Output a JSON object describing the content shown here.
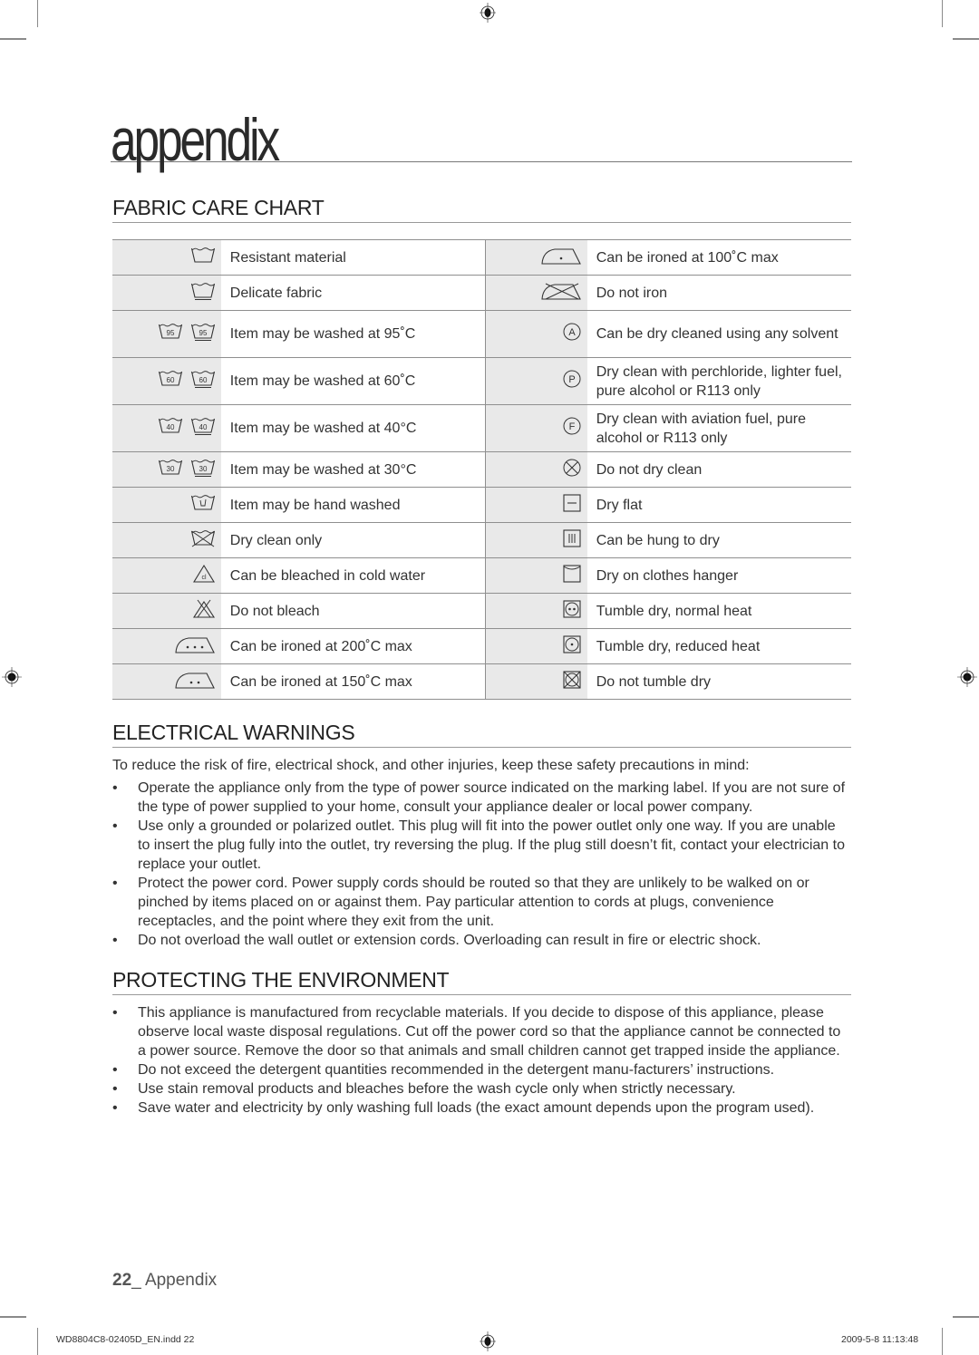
{
  "chapter_title": "appendix",
  "fabric_care": {
    "title": "FABRIC CARE CHART",
    "left": [
      {
        "icons": [
          "washtub-icon"
        ],
        "label": "Resistant material"
      },
      {
        "icons": [
          "washtub-delicate-icon"
        ],
        "label": "Delicate fabric"
      },
      {
        "icons": [
          "wash-95-icon",
          "wash-95-delicate-icon"
        ],
        "temps": [
          "95",
          "95"
        ],
        "label": "Item may be washed at 95˚C"
      },
      {
        "icons": [
          "wash-60-icon",
          "wash-60-delicate-icon"
        ],
        "temps": [
          "60",
          "60"
        ],
        "label": "Item may be washed at 60˚C"
      },
      {
        "icons": [
          "wash-40-icon",
          "wash-40-delicate-icon"
        ],
        "temps": [
          "40",
          "40"
        ],
        "label": "Item may be washed at 40°C"
      },
      {
        "icons": [
          "wash-30-icon",
          "wash-30-delicate-icon"
        ],
        "temps": [
          "30",
          "30"
        ],
        "label": "Item may be washed at 30°C"
      },
      {
        "icons": [
          "hand-wash-icon"
        ],
        "label": "Item may be hand washed"
      },
      {
        "icons": [
          "do-not-wash-icon"
        ],
        "label": "Dry clean only"
      },
      {
        "icons": [
          "bleach-cold-icon"
        ],
        "label": "Can be bleached in cold water"
      },
      {
        "icons": [
          "do-not-bleach-icon"
        ],
        "label": "Do not bleach"
      },
      {
        "icons": [
          "iron-three-dots-icon"
        ],
        "label": "Can be ironed at 200˚C max"
      },
      {
        "icons": [
          "iron-two-dots-icon"
        ],
        "label": "Can be ironed at 150˚C max"
      }
    ],
    "right": [
      {
        "icons": [
          "iron-one-dot-icon"
        ],
        "label": "Can be ironed at 100˚C max"
      },
      {
        "icons": [
          "do-not-iron-icon"
        ],
        "label": "Do not iron"
      },
      {
        "icons": [
          "dry-clean-a-icon"
        ],
        "letter": "A",
        "label": "Can be dry cleaned using any solvent"
      },
      {
        "icons": [
          "dry-clean-p-icon"
        ],
        "letter": "P",
        "label": "Dry clean with perchloride, lighter fuel, pure alcohol or R113 only"
      },
      {
        "icons": [
          "dry-clean-f-icon"
        ],
        "letter": "F",
        "label": "Dry clean with aviation fuel, pure alcohol or R113 only"
      },
      {
        "icons": [
          "do-not-dry-clean-icon"
        ],
        "label": "Do not dry clean"
      },
      {
        "icons": [
          "dry-flat-icon"
        ],
        "label": "Dry flat"
      },
      {
        "icons": [
          "hang-dry-icon"
        ],
        "label": "Can be hung to dry"
      },
      {
        "icons": [
          "clothes-hanger-dry-icon"
        ],
        "label": "Dry on clothes hanger"
      },
      {
        "icons": [
          "tumble-dry-normal-icon"
        ],
        "label": "Tumble dry, normal heat"
      },
      {
        "icons": [
          "tumble-dry-reduced-icon"
        ],
        "label": "Tumble dry, reduced heat"
      },
      {
        "icons": [
          "do-not-tumble-dry-icon"
        ],
        "label": "Do not tumble dry"
      }
    ]
  },
  "electrical": {
    "title": "ELECTRICAL WARNINGS",
    "intro": "To reduce the risk of fire, electrical shock, and other injuries, keep these safety precautions in mind:",
    "bullets": [
      "Operate the appliance only from the type of power source indicated on the marking label. If you are not sure of the type of power supplied to your home, consult your appliance dealer or local power company.",
      "Use only a grounded or polarized outlet. This plug will fit into the power outlet only one way. If you are unable to insert the plug fully into the outlet, try reversing the plug. If the plug still doesn’t fit, contact your electrician to replace your outlet.",
      "Protect the power cord. Power supply cords should be routed so that they are unlikely to be walked on or pinched by items placed on or against them. Pay particular attention to cords at plugs, convenience receptacles, and the point where they exit from the unit.",
      "Do not overload the wall outlet or extension cords. Overloading can result in fire or electric shock."
    ]
  },
  "environment": {
    "title": "PROTECTING THE ENVIRONMENT",
    "bullets": [
      "This appliance is manufactured from recyclable materials. If you decide to dispose of this appliance, please observe local waste disposal regulations. Cut off the power cord so that the appliance cannot be connected to a power source. Remove the door so that animals and small children cannot get trapped inside the appliance.",
      "Do not exceed the detergent quantities recommended in the detergent manu-facturers’ instructions.",
      "Use stain removal products and bleaches before the wash cycle only when strictly necessary.",
      "Save water and electricity by only washing full loads (the exact amount depends upon the program used)."
    ]
  },
  "footer": {
    "page_number": "22",
    "page_label": "_ Appendix",
    "slug_file": "WD8804C8-02405D_EN.indd   22",
    "slug_timestamp": "2009-5-8   11:13:48"
  }
}
